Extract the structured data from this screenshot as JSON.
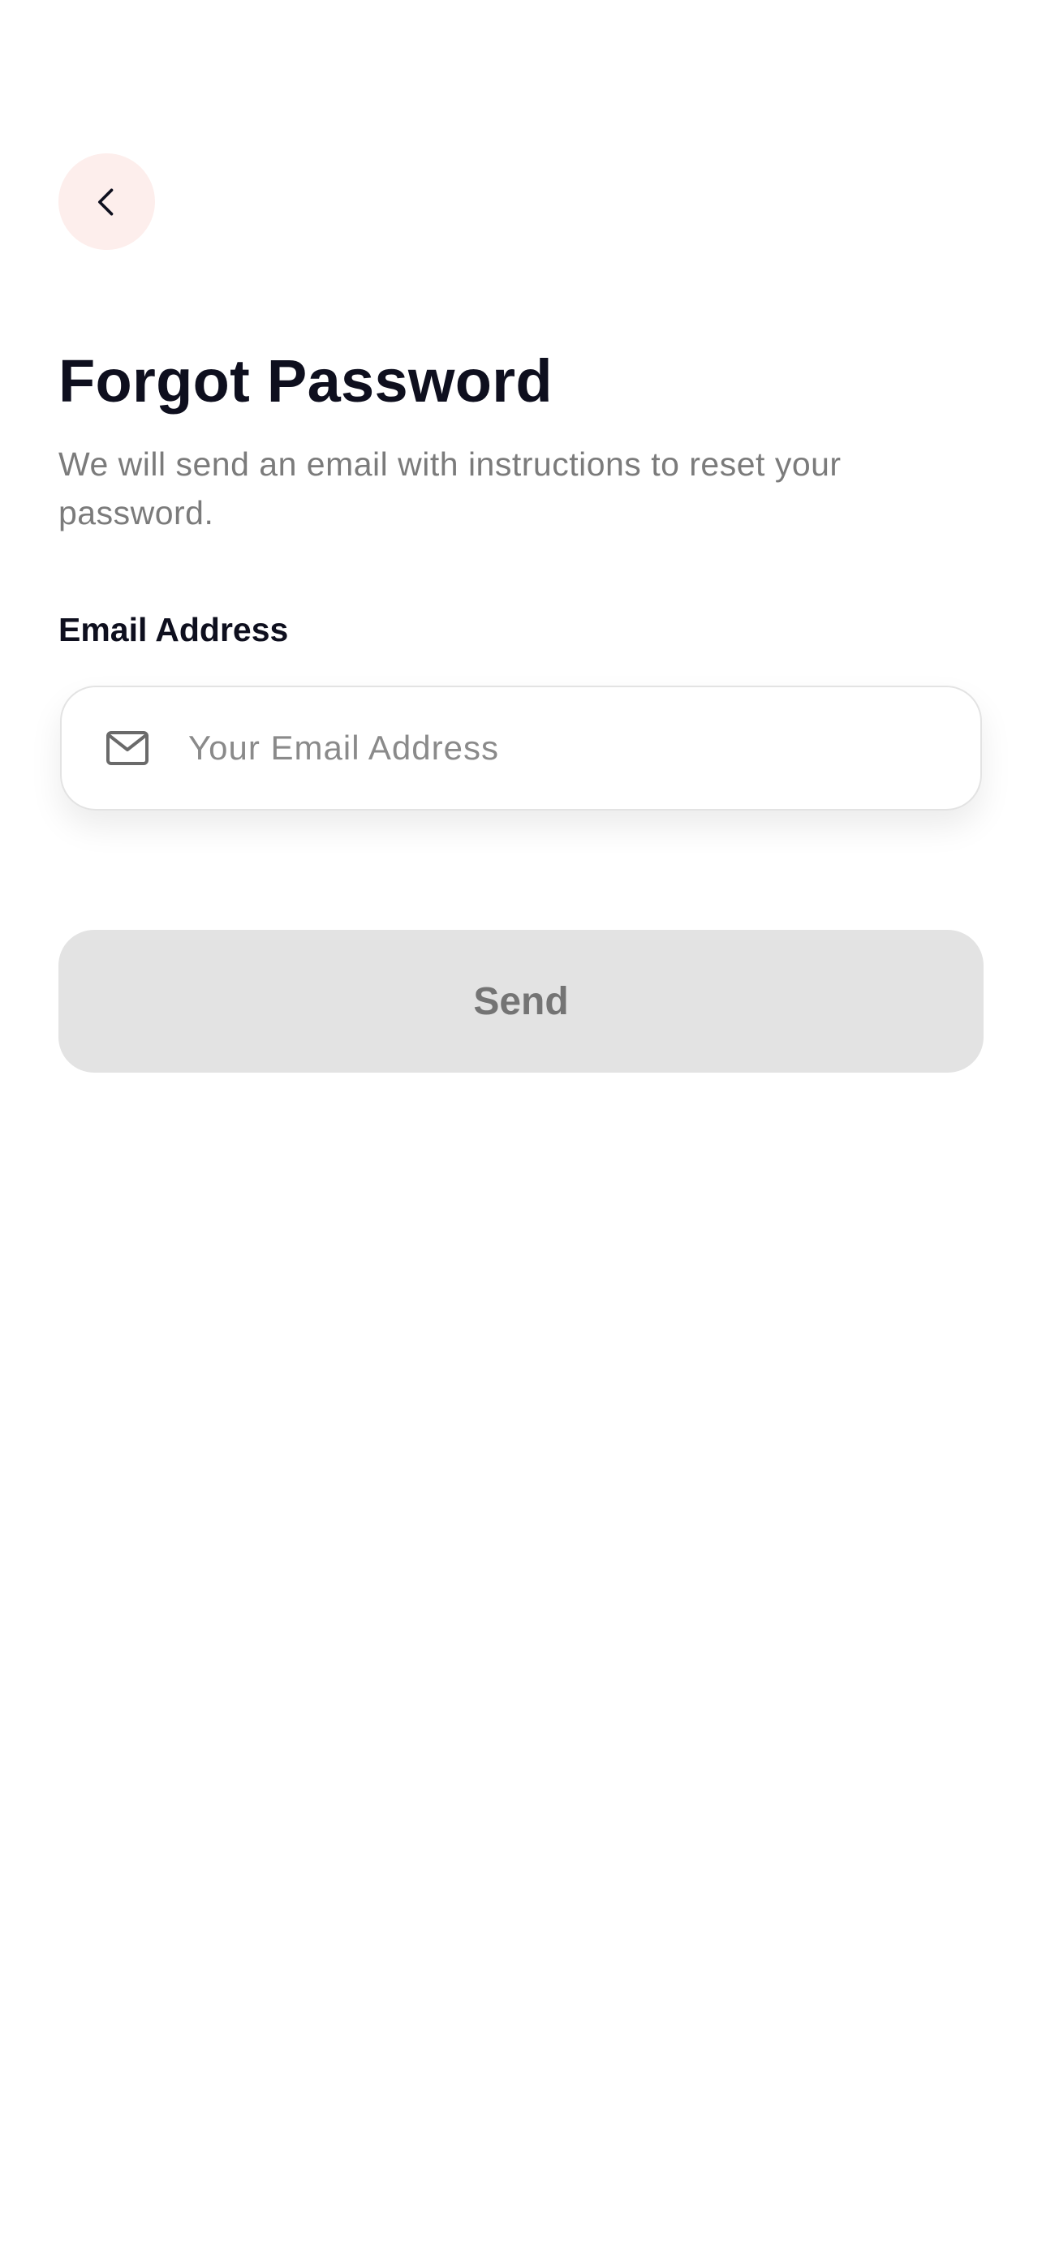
{
  "header": {
    "back_icon": "chevron-left-icon"
  },
  "main": {
    "title": "Forgot Password",
    "subtitle": "We will send an email with instructions to reset your password.",
    "email": {
      "label": "Email Address",
      "placeholder": "Your Email Address",
      "value": "",
      "icon": "mail-icon"
    },
    "send_label": "Send"
  },
  "colors": {
    "back_button_bg": "#fdeeec",
    "title": "#0e0f1e",
    "subtitle": "#7b7b7b",
    "button_disabled_bg": "#e3e3e3",
    "button_disabled_text": "#747474"
  }
}
